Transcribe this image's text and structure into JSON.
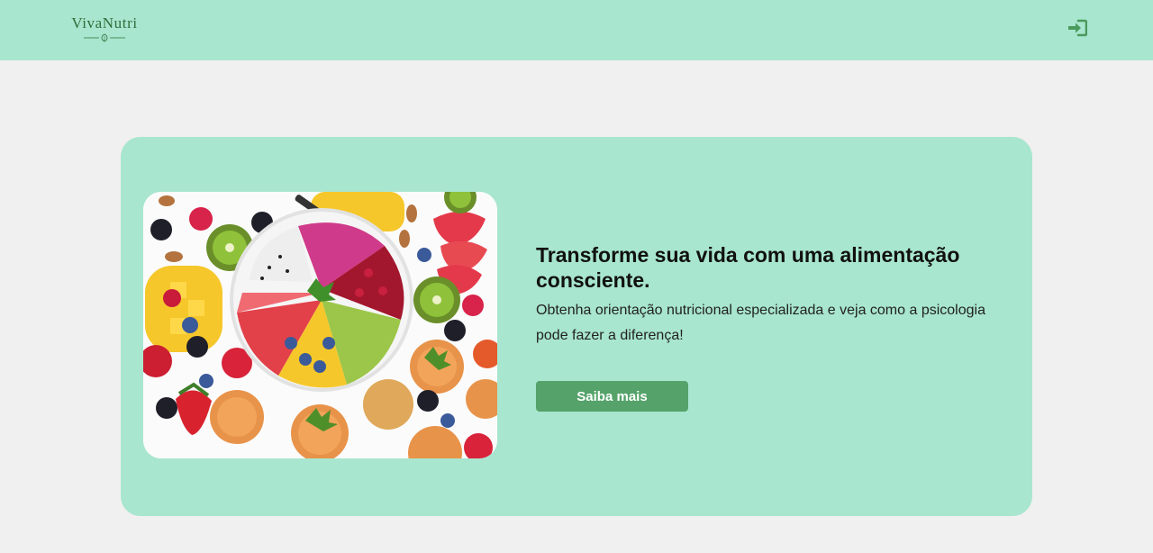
{
  "header": {
    "logo_text": "VivaNutri",
    "login_icon": "sign-in-icon"
  },
  "hero": {
    "image_description_icon": "food-bowl-image",
    "title": "Transforme sua vida com uma alimentação consciente.",
    "subtitle": "Obtenha orientação nutricional especializada e veja como a psicologia pode fazer a diferença!",
    "cta_label": "Saiba mais"
  },
  "colors": {
    "header_bg": "#a8e6cf",
    "card_bg": "#a8e6cf",
    "page_bg": "#f0f0f0",
    "button_bg": "#55a36a",
    "icon_green": "#4a9a5c"
  }
}
